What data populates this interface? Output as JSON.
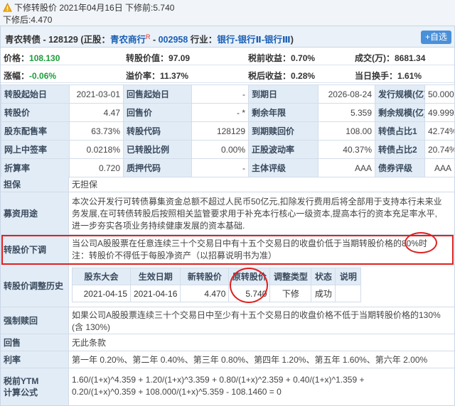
{
  "topnote": {
    "line1": "下修转股价  2021年04月16日  下修前:5.740",
    "line2": "下修后:4.470"
  },
  "header": {
    "bond_name": "青农转债 - 128129",
    "stock_prefix": "(正股：",
    "stock_name": "青农商行",
    "stock_sup": "R",
    "stock_code_sep": " - ",
    "stock_code": "002958",
    "industry_prefix": "  行业：",
    "industry": "银行-银行Ⅱ-银行Ⅲ",
    "industry_suffix": ")",
    "add_button": "+自选"
  },
  "quote_rows": [
    [
      {
        "label": "价格：",
        "value": "108.130",
        "green": true
      },
      {
        "label": "转股价值：",
        "value": "97.09"
      },
      {
        "label": "税前收益：",
        "value": "0.70%"
      },
      {
        "label": "成交(万)：",
        "value": "8681.34"
      }
    ],
    [
      {
        "label": "涨幅：",
        "value": "-0.06%",
        "green": true
      },
      {
        "label": "溢价率：",
        "value": "11.37%"
      },
      {
        "label": "税后收益：",
        "value": "0.28%"
      },
      {
        "label": "当日换手：",
        "value": "1.61%"
      }
    ]
  ],
  "grid": [
    [
      "转股起始日",
      "2021-03-01",
      "回售起始日",
      "-",
      "到期日",
      "2026-08-24",
      "发行规模(亿)",
      "50.000"
    ],
    [
      "转股价",
      "4.47",
      "回售价",
      "- *",
      "剩余年限",
      "5.359",
      "剩余规模(亿)",
      "49.999"
    ],
    [
      "股东配售率",
      "63.73%",
      "转股代码",
      "128129",
      "到期赎回价",
      "108.00",
      "转债占比1",
      "42.74%"
    ],
    [
      "网上中签率",
      "0.0218%",
      "已转股比例",
      "0.00%",
      "正股波动率",
      "40.37%",
      "转债占比2",
      "20.74%"
    ],
    [
      "折算率",
      "0.720",
      "质押代码",
      "-",
      "主体评级",
      "AAA",
      "债券评级",
      "AAA"
    ]
  ],
  "guarantee": {
    "label": "担保",
    "text": "无担保"
  },
  "funds": {
    "label": "募资用途",
    "lines": [
      "本次公开发行可转债募集资金总额不超过人民币50亿元,扣除发行费用后将全部用于支持本行未来业",
      "务发展,在可转债转股后按照相关监管要求用于补充本行核心一级资本,提高本行的资本充足率水平,",
      "进一步夯实各项业务持续健康发展的资本基础."
    ]
  },
  "reset": {
    "label": "转股价下调",
    "lines": [
      "当公司A股股票在任意连续三十个交易日中有十五个交易日的收盘价低于当期转股价格的80%时",
      "注：转股价不得低于每股净资产（以招募说明书为准）"
    ]
  },
  "history": {
    "label": "转股价调整历史",
    "headers": [
      "股东大会",
      "生效日期",
      "新转股价",
      "原转股价",
      "调整类型",
      "状态",
      "说明"
    ],
    "rows": [
      [
        "2021-04-15",
        "2021-04-16",
        "4.470",
        "5.740",
        "下修",
        "成功",
        ""
      ]
    ]
  },
  "redeem": {
    "label": "强制赎回",
    "lines": [
      "如果公司A股股票连续三十个交易日中至少有十五个交易日的收盘价格不低于当期转股价格的130%",
      "(含 130%)"
    ]
  },
  "putback": {
    "label": "回售",
    "text": "无此条款"
  },
  "rate": {
    "label": "利率",
    "text": "第一年 0.20%、第二年 0.40%、第三年 0.80%、第四年 1.20%、第五年 1.60%、第六年 2.00%"
  },
  "ytm": {
    "label_line1": "税前YTM",
    "label_line2": "计算公式",
    "lines": [
      "1.60/(1+x)^4.359 + 1.20/(1+x)^3.359 + 0.80/(1+x)^2.359 + 0.40/(1+x)^1.359 +",
      "0.20/(1+x)^0.359 + 108.000/(1+x)^5.359 - 108.1460 = 0"
    ]
  },
  "colors": {
    "accent": "#1a5fb4",
    "up_green": "#1a9e3a",
    "highlight_red": "#e02020",
    "label_bg": "#e2ecf7"
  }
}
